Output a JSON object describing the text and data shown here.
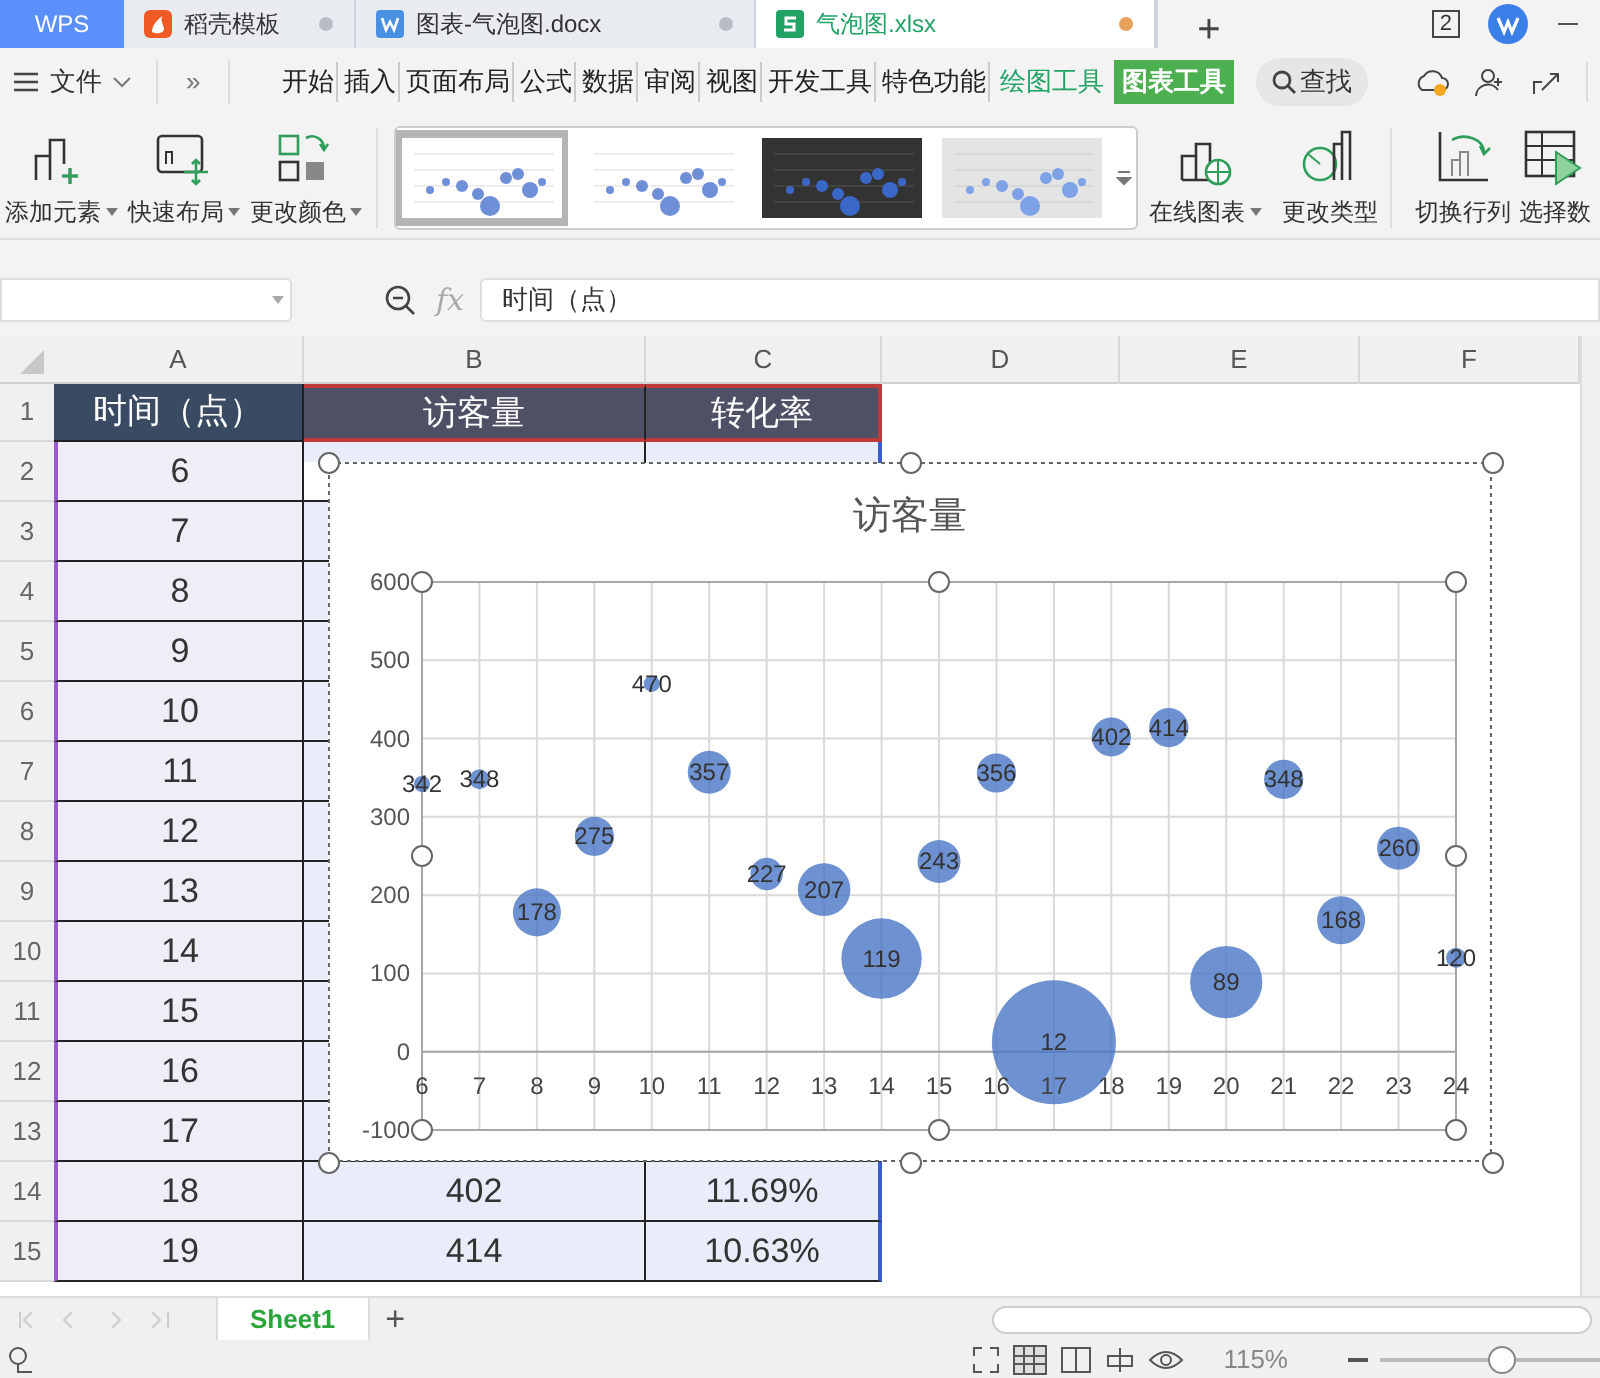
{
  "title_bar": {
    "tabs": [
      {
        "label": "WPS",
        "kind": "home",
        "selected": false
      },
      {
        "label": "稻壳模板",
        "kind": "docer",
        "selected": false
      },
      {
        "label": "图表-气泡图.docx",
        "kind": "writer",
        "selected": false
      },
      {
        "label": "气泡图.xlsx",
        "kind": "sheet",
        "selected": true
      }
    ],
    "new_tab": "+",
    "badge": "2"
  },
  "menu": {
    "file": "文件",
    "more": "»",
    "tabs": [
      {
        "label": "开始",
        "selected": false
      },
      {
        "label": "插入",
        "selected": false
      },
      {
        "label": "页面布局",
        "selected": false
      },
      {
        "label": "公式",
        "selected": false
      },
      {
        "label": "数据",
        "selected": false
      },
      {
        "label": "审阅",
        "selected": false
      },
      {
        "label": "视图",
        "selected": false
      },
      {
        "label": "开发工具",
        "selected": false
      },
      {
        "label": "特色功能",
        "selected": false
      },
      {
        "label": "绘图工具",
        "selected": false
      },
      {
        "label": "图表工具",
        "selected": true
      }
    ],
    "search": "查找"
  },
  "ribbon": {
    "left_buttons": [
      {
        "label": "添加元素",
        "kind": "add",
        "dropdown": true
      },
      {
        "label": "快速布局",
        "kind": "layout",
        "dropdown": true
      },
      {
        "label": "更改颜色",
        "kind": "color",
        "dropdown": true
      }
    ],
    "styles": [
      {
        "kind": "light",
        "selected": true
      },
      {
        "kind": "light",
        "selected": false
      },
      {
        "kind": "dark",
        "selected": false
      },
      {
        "kind": "gradient",
        "selected": false
      }
    ],
    "right_buttons": [
      {
        "label": "在线图表",
        "kind": "online",
        "dropdown": true
      },
      {
        "label": "更改类型",
        "kind": "type",
        "dropdown": false
      },
      {
        "label": "切换行列",
        "kind": "switch",
        "dropdown": false
      },
      {
        "label": "选择数",
        "kind": "select",
        "dropdown": false
      }
    ]
  },
  "formula_bar": {
    "fx": "fx",
    "value": "时间（点）"
  },
  "sheet": {
    "columns": [
      "A",
      "B",
      "C",
      "D",
      "E",
      "F"
    ],
    "rows": [
      {
        "number": "1",
        "cells": [
          "时间（点）",
          "访客量",
          "转化率"
        ]
      },
      {
        "number": "2",
        "cells": [
          "6"
        ]
      },
      {
        "number": "3",
        "cells": [
          "7"
        ]
      },
      {
        "number": "4",
        "cells": [
          "8"
        ]
      },
      {
        "number": "5",
        "cells": [
          "9"
        ]
      },
      {
        "number": "6",
        "cells": [
          "10"
        ]
      },
      {
        "number": "7",
        "cells": [
          "11"
        ]
      },
      {
        "number": "8",
        "cells": [
          "12"
        ]
      },
      {
        "number": "9",
        "cells": [
          "13"
        ]
      },
      {
        "number": "10",
        "cells": [
          "14"
        ]
      },
      {
        "number": "11",
        "cells": [
          "15"
        ]
      },
      {
        "number": "12",
        "cells": [
          "16"
        ]
      },
      {
        "number": "13",
        "cells": [
          "17"
        ]
      },
      {
        "number": "14",
        "cells": [
          "18",
          "402",
          "11.69%"
        ]
      },
      {
        "number": "15",
        "cells": [
          "19",
          "414",
          "10.63%"
        ]
      }
    ]
  },
  "chart": {
    "chart_data": {
      "type": "scatter",
      "title": "访客量",
      "x": [
        6,
        7,
        8,
        9,
        10,
        11,
        12,
        13,
        14,
        15,
        16,
        17,
        18,
        19,
        20,
        21,
        22,
        23,
        24
      ],
      "series": [
        {
          "color": "#4472c4",
          "values": [
            342,
            348,
            178,
            275,
            470,
            357,
            227,
            207,
            119,
            243,
            356,
            12,
            402,
            414,
            89,
            348,
            168,
            260,
            120
          ],
          "sizes": [
            0.017,
            0.026,
            0.15,
            0.1,
            0.017,
            0.12,
            0.068,
            0.18,
            0.42,
            0.12,
            0.1,
            1,
            0.1,
            0.1,
            0.34,
            0.1,
            0.15,
            0.12,
            0.026
          ]
        }
      ],
      "grid": true,
      "xlim": [
        6,
        24
      ],
      "ylim": [
        -100,
        600
      ],
      "xticks": [
        6,
        7,
        8,
        9,
        10,
        11,
        12,
        13,
        14,
        15,
        16,
        17,
        18,
        19,
        20,
        21,
        22,
        23,
        24
      ],
      "yticks": [
        -100,
        0,
        100,
        200,
        300,
        400,
        500,
        600
      ],
      "data_labels": true
    }
  },
  "sheet_tabs": [
    {
      "label": "Sheet1",
      "selected": true
    }
  ],
  "add_sheet": "+",
  "status_bar": {
    "zoom": "115%",
    "zoom_slider": {
      "level": 0.55
    }
  }
}
